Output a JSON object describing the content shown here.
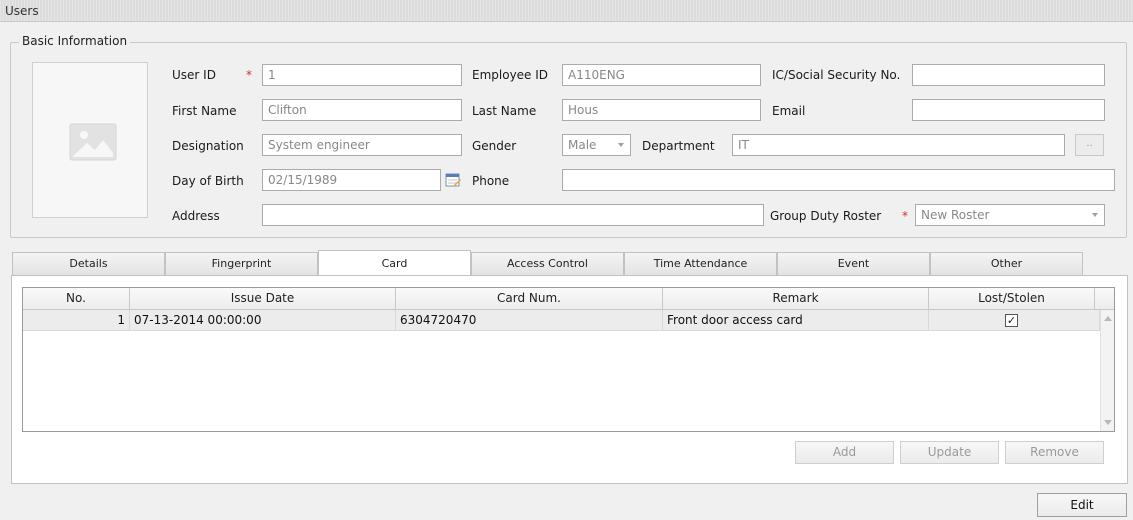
{
  "window": {
    "title": "Users"
  },
  "basic_info": {
    "legend": "Basic Information",
    "required_mark": "*",
    "labels": {
      "user_id": "User ID",
      "employee_id": "Employee ID",
      "ic_ssn": "IC/Social Security No.",
      "first_name": "First Name",
      "last_name": "Last Name",
      "email": "Email",
      "designation": "Designation",
      "gender": "Gender",
      "department": "Department",
      "dob": "Day of Birth",
      "phone": "Phone",
      "address": "Address",
      "group_duty_roster": "Group Duty Roster"
    },
    "values": {
      "user_id": "1",
      "employee_id": "A110ENG",
      "ic_ssn": "",
      "first_name": "Clifton",
      "last_name": "Hous",
      "email": "",
      "designation": "System engineer",
      "gender": "Male",
      "department": "IT",
      "dob": "02/15/1989",
      "phone": "",
      "address": "",
      "group_duty_roster": "New Roster"
    },
    "department_browse_label": ".."
  },
  "tabs": [
    "Details",
    "Fingerprint",
    "Card",
    "Access Control",
    "Time Attendance",
    "Event",
    "Other"
  ],
  "active_tab": "Card",
  "card_grid": {
    "columns": [
      "No.",
      "Issue Date",
      "Card Num.",
      "Remark",
      "Lost/Stolen"
    ],
    "rows": [
      {
        "no": "1",
        "issue_date": "07-13-2014 00:00:00",
        "card_num": "6304720470",
        "remark": "Front door access card",
        "lost_stolen": true
      }
    ]
  },
  "buttons": {
    "add": "Add",
    "update": "Update",
    "remove": "Remove",
    "edit": "Edit"
  },
  "icons": {
    "photo": "image-placeholder-icon",
    "calendar": "calendar-icon",
    "checkbox": "checkmark-icon"
  }
}
